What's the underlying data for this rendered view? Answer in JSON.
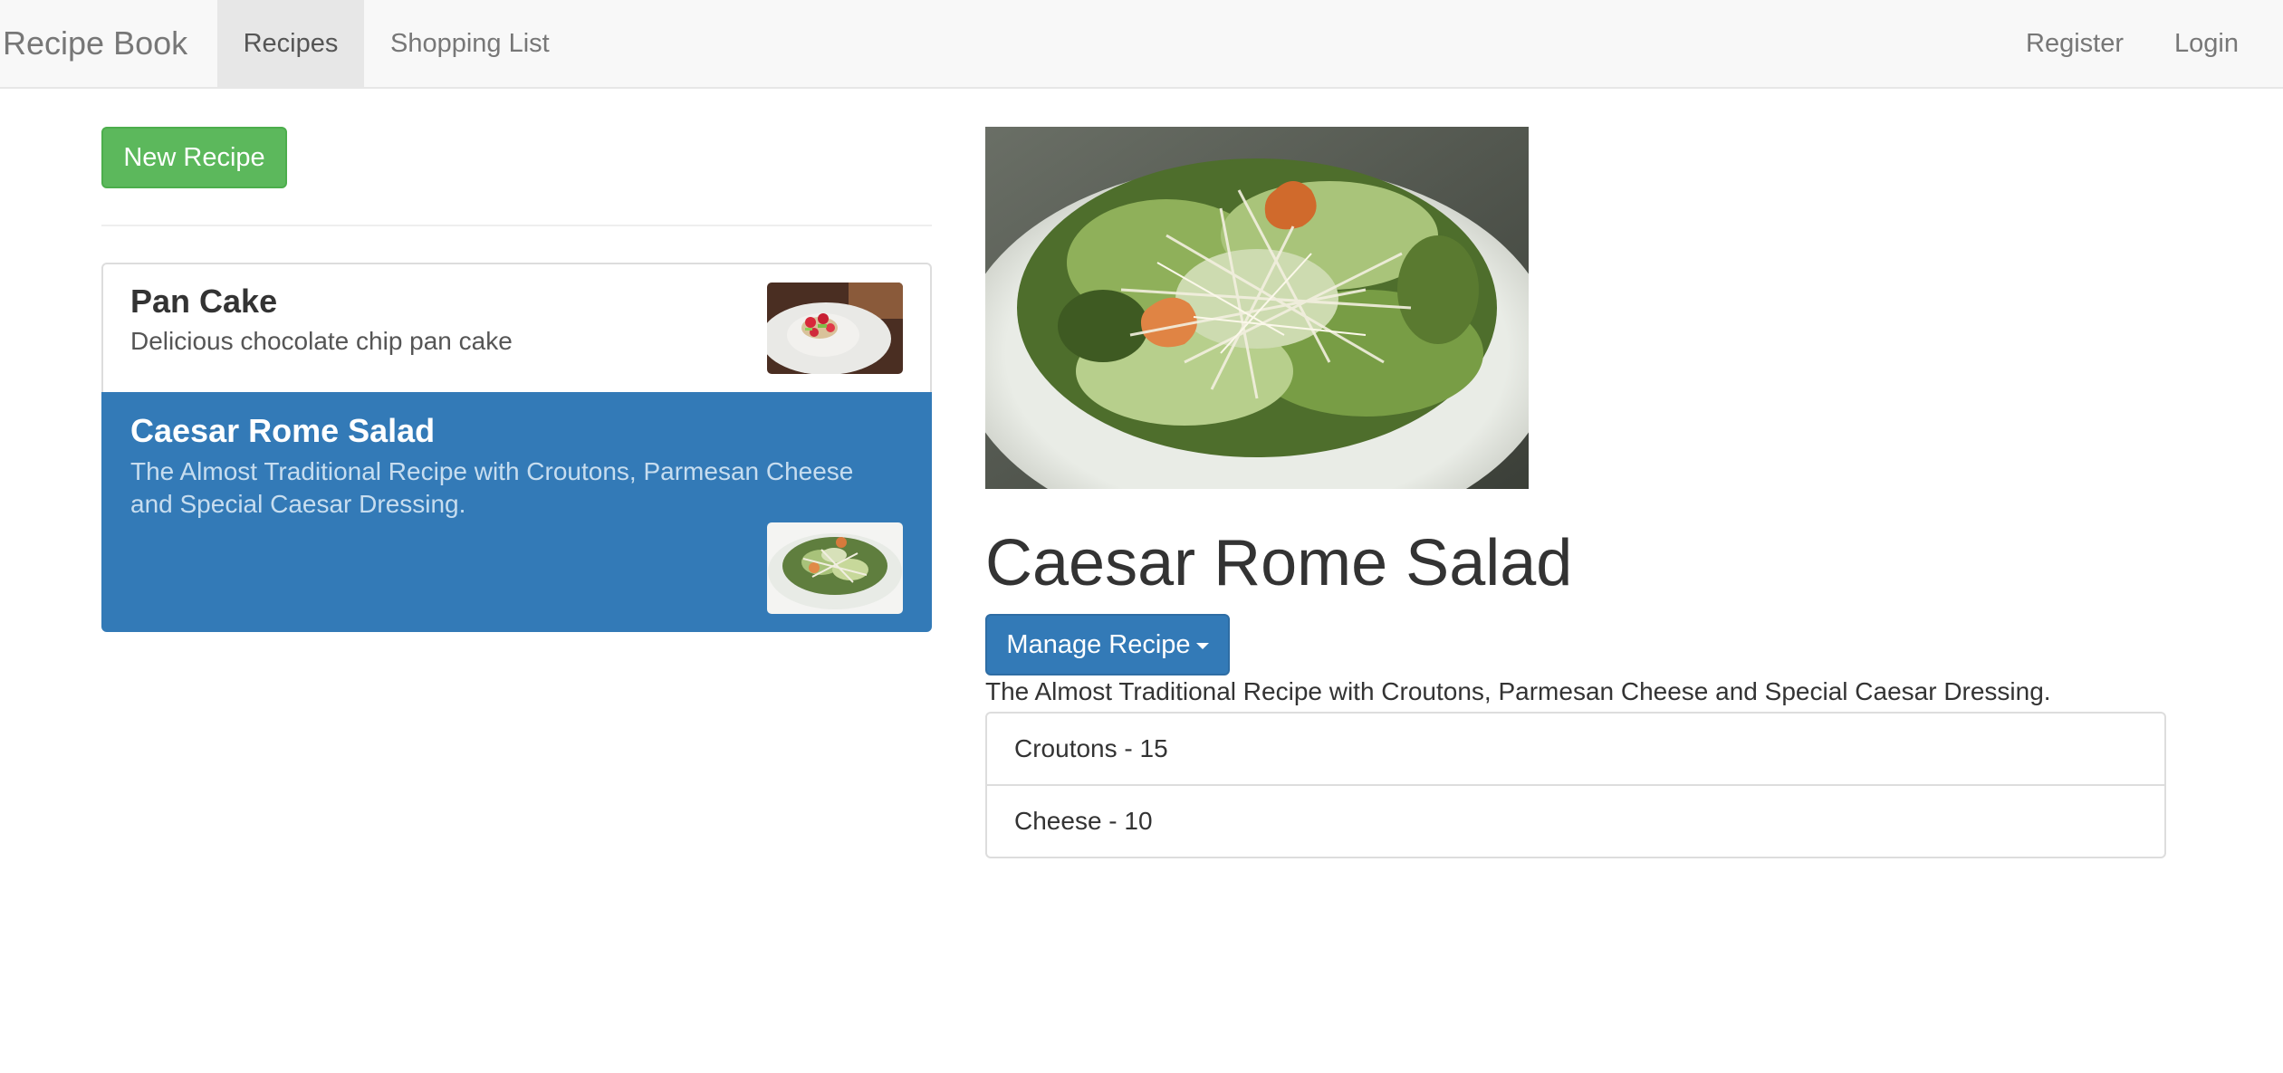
{
  "nav": {
    "brand": "Recipe Book",
    "links": [
      "Recipes",
      "Shopping List"
    ],
    "right_links": [
      "Register",
      "Login"
    ],
    "active": "Recipes"
  },
  "sidebar": {
    "new_button": "New Recipe",
    "recipes": [
      {
        "name": "Pan Cake",
        "description": "Delicious chocolate chip pan cake"
      },
      {
        "name": "Caesar Rome Salad",
        "description": "The Almost Traditional Recipe with Croutons, Parmesan Cheese and Special Caesar Dressing."
      }
    ],
    "selected": "Caesar Rome Salad"
  },
  "detail": {
    "name": "Caesar Rome Salad",
    "manage_button": "Manage Recipe",
    "description": "The Almost Traditional Recipe with Croutons, Parmesan Cheese and Special Caesar Dressing.",
    "ingredients": [
      "Croutons - 15",
      "Cheese - 10"
    ]
  },
  "colors": {
    "success": "#5cb85c",
    "primary": "#337ab7",
    "navbar": "#f8f8f8"
  }
}
